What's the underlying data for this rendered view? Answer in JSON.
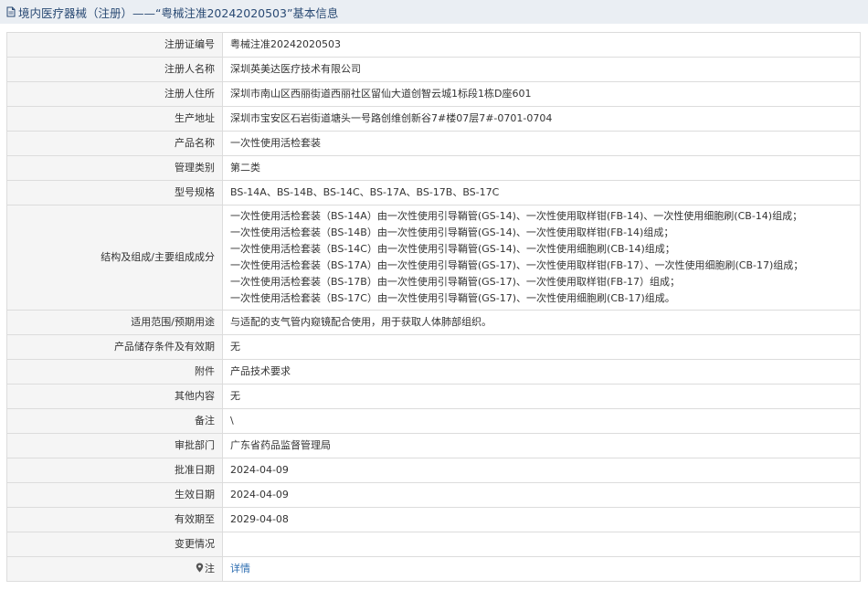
{
  "header": {
    "title": "境内医疗器械（注册）——“粤械注准20242020503”基本信息"
  },
  "rows": {
    "reg_no": {
      "label": "注册证编号",
      "value": "粤械注准20242020503"
    },
    "registrant": {
      "label": "注册人名称",
      "value": "深圳英美达医疗技术有限公司"
    },
    "registrant_addr": {
      "label": "注册人住所",
      "value": "深圳市南山区西丽街道西丽社区留仙大道创智云城1标段1栋D座601"
    },
    "prod_addr": {
      "label": "生产地址",
      "value": "深圳市宝安区石岩街道塘头一号路创维创新谷7#楼07层7#-0701-0704"
    },
    "product_name": {
      "label": "产品名称",
      "value": "一次性使用活检套装"
    },
    "category": {
      "label": "管理类别",
      "value": "第二类"
    },
    "model": {
      "label": "型号规格",
      "value": "BS-14A、BS-14B、BS-14C、BS-17A、BS-17B、BS-17C"
    },
    "structure": {
      "label": "结构及组成/主要组成成分",
      "lines": [
        "一次性使用活检套装（BS-14A）由一次性使用引导鞘管(GS-14)、一次性使用取样钳(FB-14)、一次性使用细胞刷(CB-14)组成；",
        "一次性使用活检套装（BS-14B）由一次性使用引导鞘管(GS-14)、一次性使用取样钳(FB-14)组成；",
        "一次性使用活检套装（BS-14C）由一次性使用引导鞘管(GS-14)、一次性使用细胞刷(CB-14)组成；",
        "一次性使用活检套装（BS-17A）由一次性使用引导鞘管(GS-17)、一次性使用取样钳(FB-17）、一次性使用细胞刷(CB-17)组成；",
        "一次性使用活检套装（BS-17B）由一次性使用引导鞘管(GS-17)、一次性使用取样钳(FB-17）组成；",
        "一次性使用活检套装（BS-17C）由一次性使用引导鞘管(GS-17)、一次性使用细胞刷(CB-17)组成。"
      ]
    },
    "scope": {
      "label": "适用范围/预期用途",
      "value": "与适配的支气管内窥镜配合使用，用于获取人体肺部组织。"
    },
    "storage": {
      "label": "产品储存条件及有效期",
      "value": "无"
    },
    "attachment": {
      "label": "附件",
      "value": "产品技术要求"
    },
    "other": {
      "label": "其他内容",
      "value": "无"
    },
    "remark": {
      "label": "备注",
      "value": "\\"
    },
    "approval_dept": {
      "label": "审批部门",
      "value": "广东省药品监督管理局"
    },
    "approval_date": {
      "label": "批准日期",
      "value": "2024-04-09"
    },
    "effective_date": {
      "label": "生效日期",
      "value": "2024-04-09"
    },
    "expiry_date": {
      "label": "有效期至",
      "value": "2029-04-08"
    },
    "changes": {
      "label": "变更情况",
      "value": ""
    },
    "note": {
      "label": "注",
      "value": "详情",
      "icon": "map-pin-icon"
    }
  },
  "colors": {
    "header_bg": "#eaeef3",
    "header_text": "#2a4a74",
    "label_bg": "#f5f5f5",
    "link": "#2b6cb0",
    "border": "#dcdcdc"
  }
}
